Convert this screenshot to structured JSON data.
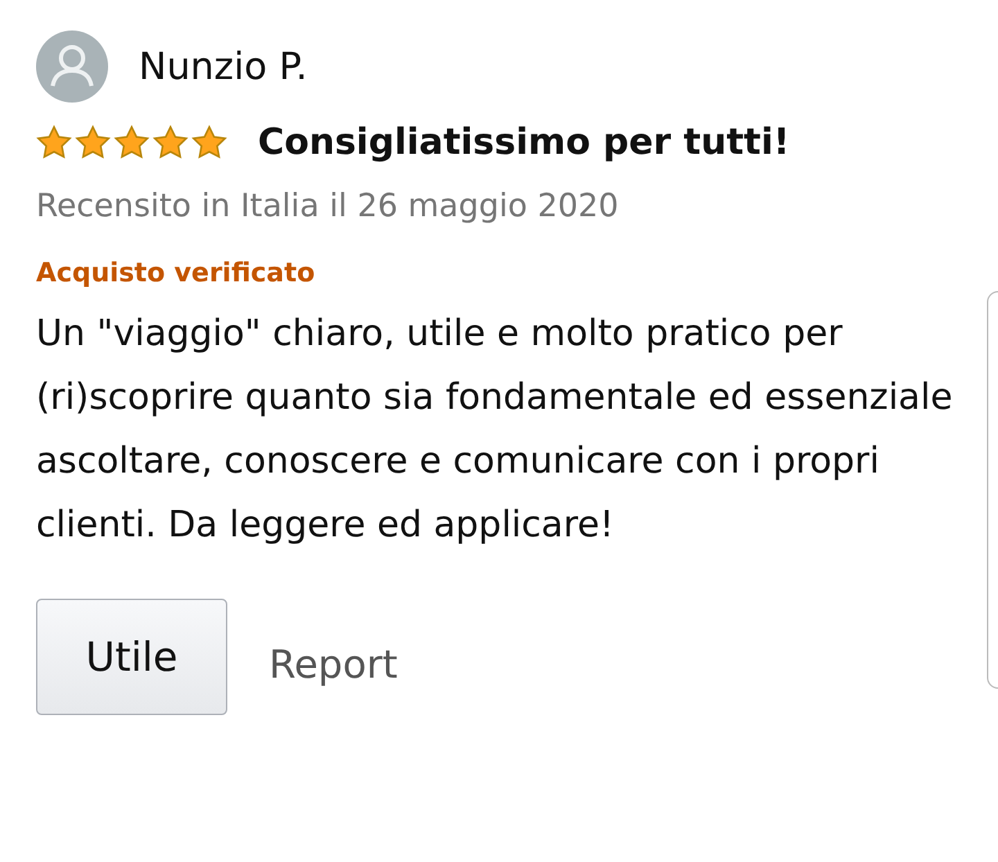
{
  "review": {
    "author": "Nunzio P.",
    "stars": 5,
    "title": "Consigliatissimo per tutti!",
    "date": "Recensito in Italia il 26 maggio 2020",
    "badge": "Acquisto verificato",
    "body": "Un \"viaggio\" chiaro, utile e molto pratico per (ri)scoprire quanto sia fondamentale ed essenziale ascoltare, conoscere e comunicare con i propri clienti. Da leggere ed applicare!"
  },
  "actions": {
    "helpful": "Utile",
    "report": "Report"
  }
}
